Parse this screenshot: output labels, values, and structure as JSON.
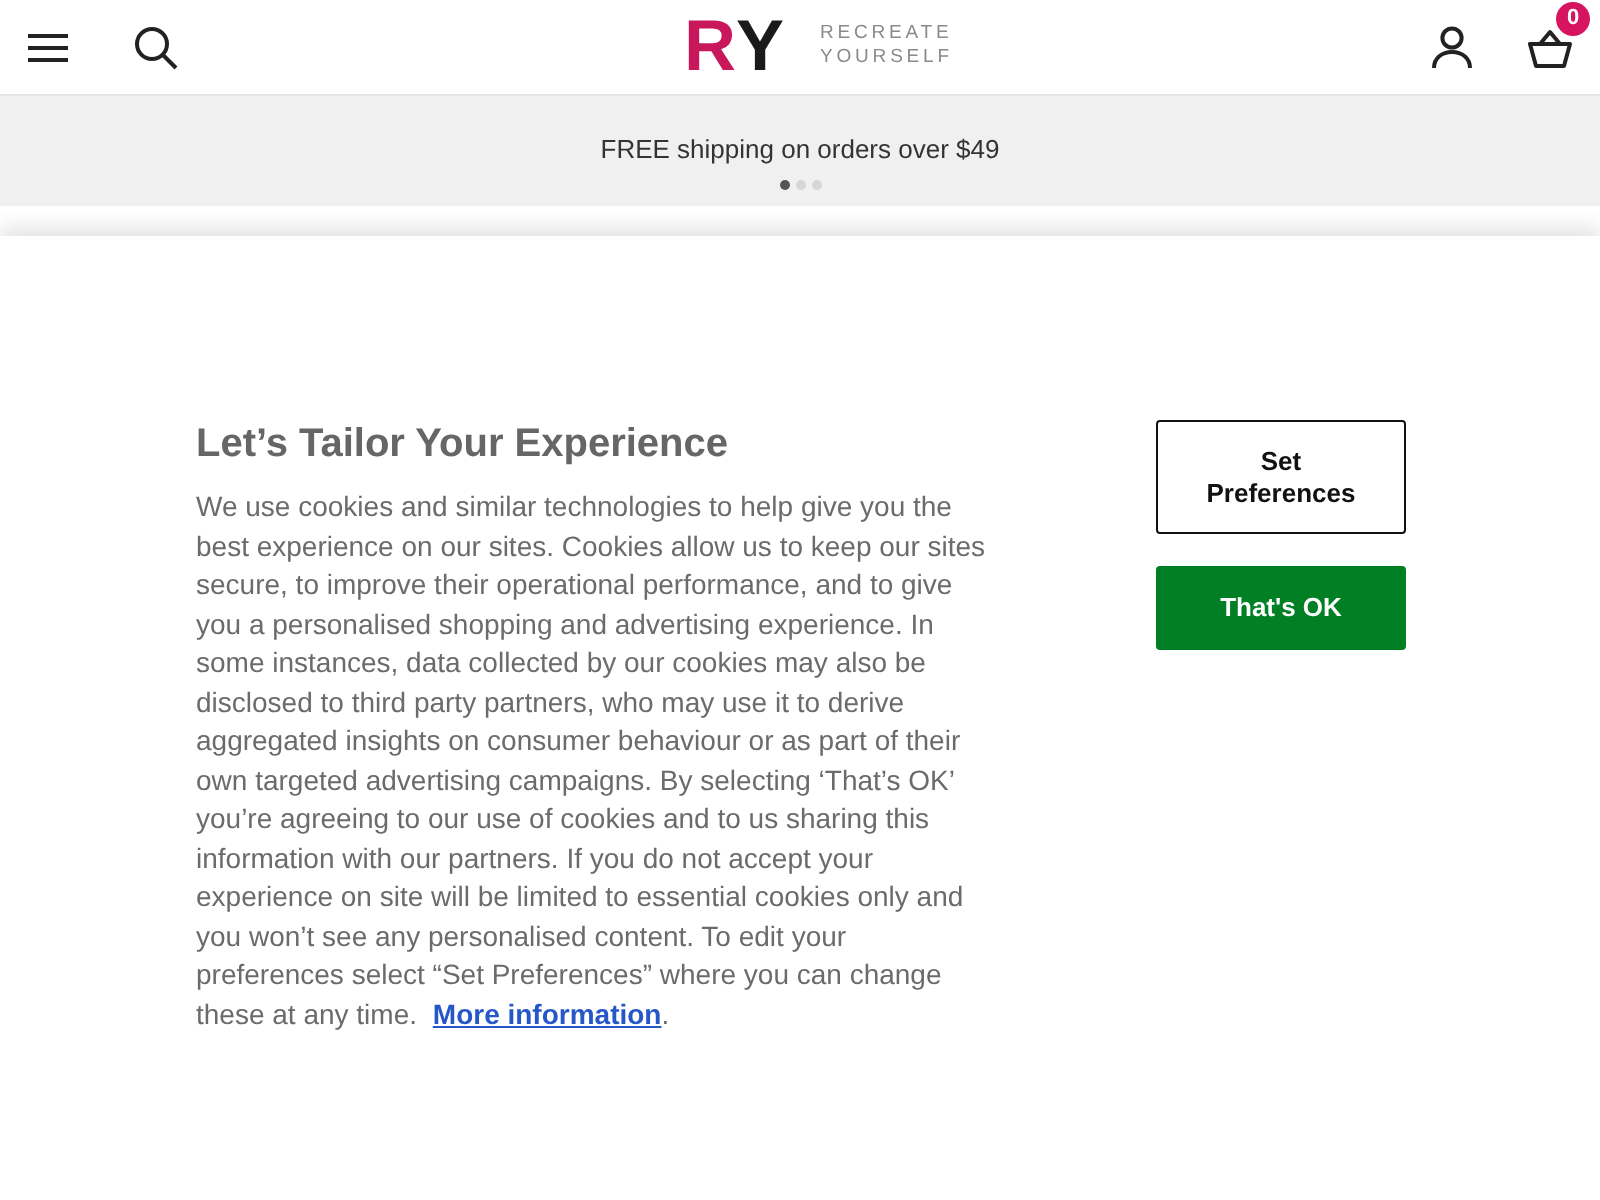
{
  "header": {
    "logo": {
      "letters": [
        {
          "text": "R",
          "color": "#c8175a"
        },
        {
          "text": "Y",
          "color": "#1a1a1a"
        }
      ],
      "tagline": "RECREATE YOURSELF"
    },
    "basket_count": "0"
  },
  "promo_banner": {
    "text": "FREE shipping on orders over $49",
    "slides": [
      {
        "selected": true
      },
      {
        "selected": false
      },
      {
        "selected": false
      }
    ]
  },
  "cookie_dialog": {
    "title": "Let’s Tailor Your Experience",
    "body": "We use cookies and similar technologies to help give you the best experience on our sites. Cookies allow us to keep our sites secure, to improve their operational performance, and to give you a personalised shopping and advertising experience. In some instances, data collected by our cookies may also be disclosed to third party partners, who may use it to derive aggregated insights on consumer behaviour or as part of their own targeted advertising campaigns. By selecting ‘That’s OK’ you’re agreeing to our use of cookies and to us sharing this information with our partners. If you do not accept your experience on site will be limited to essential cookies only and you won’t see any personalised content. To edit your preferences select “Set Preferences” where you can change these at any time.",
    "link": "More information",
    "link_suffix": ".",
    "buttons": [
      {
        "label": "Set Preferences",
        "kind": "outline"
      },
      {
        "label": "That's OK",
        "kind": "primary"
      }
    ]
  }
}
